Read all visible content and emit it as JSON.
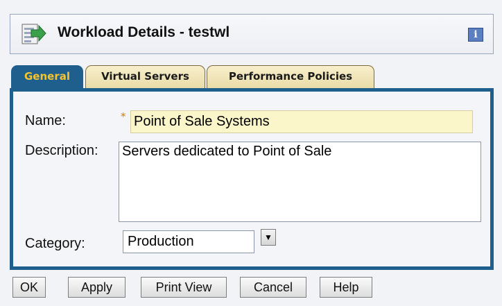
{
  "header": {
    "title": "Workload Details - testwl",
    "icon": "workload-icon",
    "info_label": "i"
  },
  "tabs": [
    {
      "label": "General",
      "active": true
    },
    {
      "label": "Virtual Servers",
      "active": false
    },
    {
      "label": "Performance Policies",
      "active": false
    }
  ],
  "form": {
    "name_label": "Name:",
    "required_marker": "*",
    "name_value": "Point of Sale Systems",
    "description_label": "Description:",
    "description_value": "Servers dedicated to Point of Sale",
    "category_label": "Category:",
    "category_value": "Production"
  },
  "buttons": {
    "ok": "OK",
    "apply": "Apply",
    "print_view": "Print View",
    "cancel": "Cancel",
    "help": "Help"
  },
  "colors": {
    "tab_active_bg": "#1f5f8d",
    "tab_active_text": "#f4c430",
    "required_input_bg": "#fbf6c9"
  }
}
